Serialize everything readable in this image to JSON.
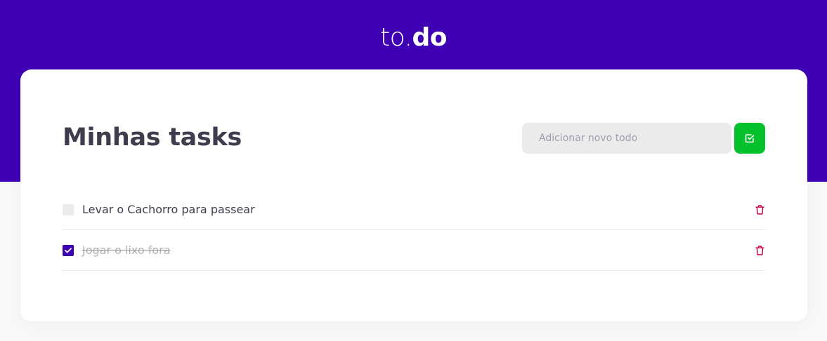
{
  "header": {
    "logo_light": "to.",
    "logo_bold": "do",
    "background_color": "#3f00b3"
  },
  "main": {
    "title": "Minhas tasks",
    "new_todo": {
      "placeholder": "Adicionar novo todo",
      "value": ""
    },
    "add_button": {
      "icon": "check-square-icon",
      "color": "#04c12c"
    }
  },
  "tasks": [
    {
      "title": "Levar o Cachorro para passear",
      "completed": false,
      "delete_icon": "trash-icon"
    },
    {
      "title": "Jogar o lixo fora",
      "completed": true,
      "delete_icon": "trash-icon"
    }
  ],
  "colors": {
    "accent": "#3f00b3",
    "success": "#04c12c",
    "danger": "#e83f5b"
  }
}
